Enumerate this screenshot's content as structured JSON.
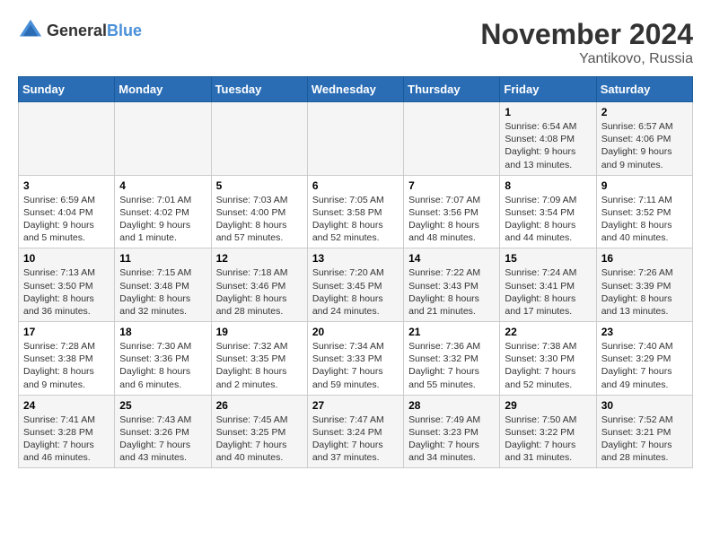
{
  "header": {
    "logo_general": "General",
    "logo_blue": "Blue",
    "month": "November 2024",
    "location": "Yantikovo, Russia"
  },
  "weekdays": [
    "Sunday",
    "Monday",
    "Tuesday",
    "Wednesday",
    "Thursday",
    "Friday",
    "Saturday"
  ],
  "weeks": [
    [
      {
        "day": "",
        "info": ""
      },
      {
        "day": "",
        "info": ""
      },
      {
        "day": "",
        "info": ""
      },
      {
        "day": "",
        "info": ""
      },
      {
        "day": "",
        "info": ""
      },
      {
        "day": "1",
        "info": "Sunrise: 6:54 AM\nSunset: 4:08 PM\nDaylight: 9 hours and 13 minutes."
      },
      {
        "day": "2",
        "info": "Sunrise: 6:57 AM\nSunset: 4:06 PM\nDaylight: 9 hours and 9 minutes."
      }
    ],
    [
      {
        "day": "3",
        "info": "Sunrise: 6:59 AM\nSunset: 4:04 PM\nDaylight: 9 hours and 5 minutes."
      },
      {
        "day": "4",
        "info": "Sunrise: 7:01 AM\nSunset: 4:02 PM\nDaylight: 9 hours and 1 minute."
      },
      {
        "day": "5",
        "info": "Sunrise: 7:03 AM\nSunset: 4:00 PM\nDaylight: 8 hours and 57 minutes."
      },
      {
        "day": "6",
        "info": "Sunrise: 7:05 AM\nSunset: 3:58 PM\nDaylight: 8 hours and 52 minutes."
      },
      {
        "day": "7",
        "info": "Sunrise: 7:07 AM\nSunset: 3:56 PM\nDaylight: 8 hours and 48 minutes."
      },
      {
        "day": "8",
        "info": "Sunrise: 7:09 AM\nSunset: 3:54 PM\nDaylight: 8 hours and 44 minutes."
      },
      {
        "day": "9",
        "info": "Sunrise: 7:11 AM\nSunset: 3:52 PM\nDaylight: 8 hours and 40 minutes."
      }
    ],
    [
      {
        "day": "10",
        "info": "Sunrise: 7:13 AM\nSunset: 3:50 PM\nDaylight: 8 hours and 36 minutes."
      },
      {
        "day": "11",
        "info": "Sunrise: 7:15 AM\nSunset: 3:48 PM\nDaylight: 8 hours and 32 minutes."
      },
      {
        "day": "12",
        "info": "Sunrise: 7:18 AM\nSunset: 3:46 PM\nDaylight: 8 hours and 28 minutes."
      },
      {
        "day": "13",
        "info": "Sunrise: 7:20 AM\nSunset: 3:45 PM\nDaylight: 8 hours and 24 minutes."
      },
      {
        "day": "14",
        "info": "Sunrise: 7:22 AM\nSunset: 3:43 PM\nDaylight: 8 hours and 21 minutes."
      },
      {
        "day": "15",
        "info": "Sunrise: 7:24 AM\nSunset: 3:41 PM\nDaylight: 8 hours and 17 minutes."
      },
      {
        "day": "16",
        "info": "Sunrise: 7:26 AM\nSunset: 3:39 PM\nDaylight: 8 hours and 13 minutes."
      }
    ],
    [
      {
        "day": "17",
        "info": "Sunrise: 7:28 AM\nSunset: 3:38 PM\nDaylight: 8 hours and 9 minutes."
      },
      {
        "day": "18",
        "info": "Sunrise: 7:30 AM\nSunset: 3:36 PM\nDaylight: 8 hours and 6 minutes."
      },
      {
        "day": "19",
        "info": "Sunrise: 7:32 AM\nSunset: 3:35 PM\nDaylight: 8 hours and 2 minutes."
      },
      {
        "day": "20",
        "info": "Sunrise: 7:34 AM\nSunset: 3:33 PM\nDaylight: 7 hours and 59 minutes."
      },
      {
        "day": "21",
        "info": "Sunrise: 7:36 AM\nSunset: 3:32 PM\nDaylight: 7 hours and 55 minutes."
      },
      {
        "day": "22",
        "info": "Sunrise: 7:38 AM\nSunset: 3:30 PM\nDaylight: 7 hours and 52 minutes."
      },
      {
        "day": "23",
        "info": "Sunrise: 7:40 AM\nSunset: 3:29 PM\nDaylight: 7 hours and 49 minutes."
      }
    ],
    [
      {
        "day": "24",
        "info": "Sunrise: 7:41 AM\nSunset: 3:28 PM\nDaylight: 7 hours and 46 minutes."
      },
      {
        "day": "25",
        "info": "Sunrise: 7:43 AM\nSunset: 3:26 PM\nDaylight: 7 hours and 43 minutes."
      },
      {
        "day": "26",
        "info": "Sunrise: 7:45 AM\nSunset: 3:25 PM\nDaylight: 7 hours and 40 minutes."
      },
      {
        "day": "27",
        "info": "Sunrise: 7:47 AM\nSunset: 3:24 PM\nDaylight: 7 hours and 37 minutes."
      },
      {
        "day": "28",
        "info": "Sunrise: 7:49 AM\nSunset: 3:23 PM\nDaylight: 7 hours and 34 minutes."
      },
      {
        "day": "29",
        "info": "Sunrise: 7:50 AM\nSunset: 3:22 PM\nDaylight: 7 hours and 31 minutes."
      },
      {
        "day": "30",
        "info": "Sunrise: 7:52 AM\nSunset: 3:21 PM\nDaylight: 7 hours and 28 minutes."
      }
    ]
  ]
}
